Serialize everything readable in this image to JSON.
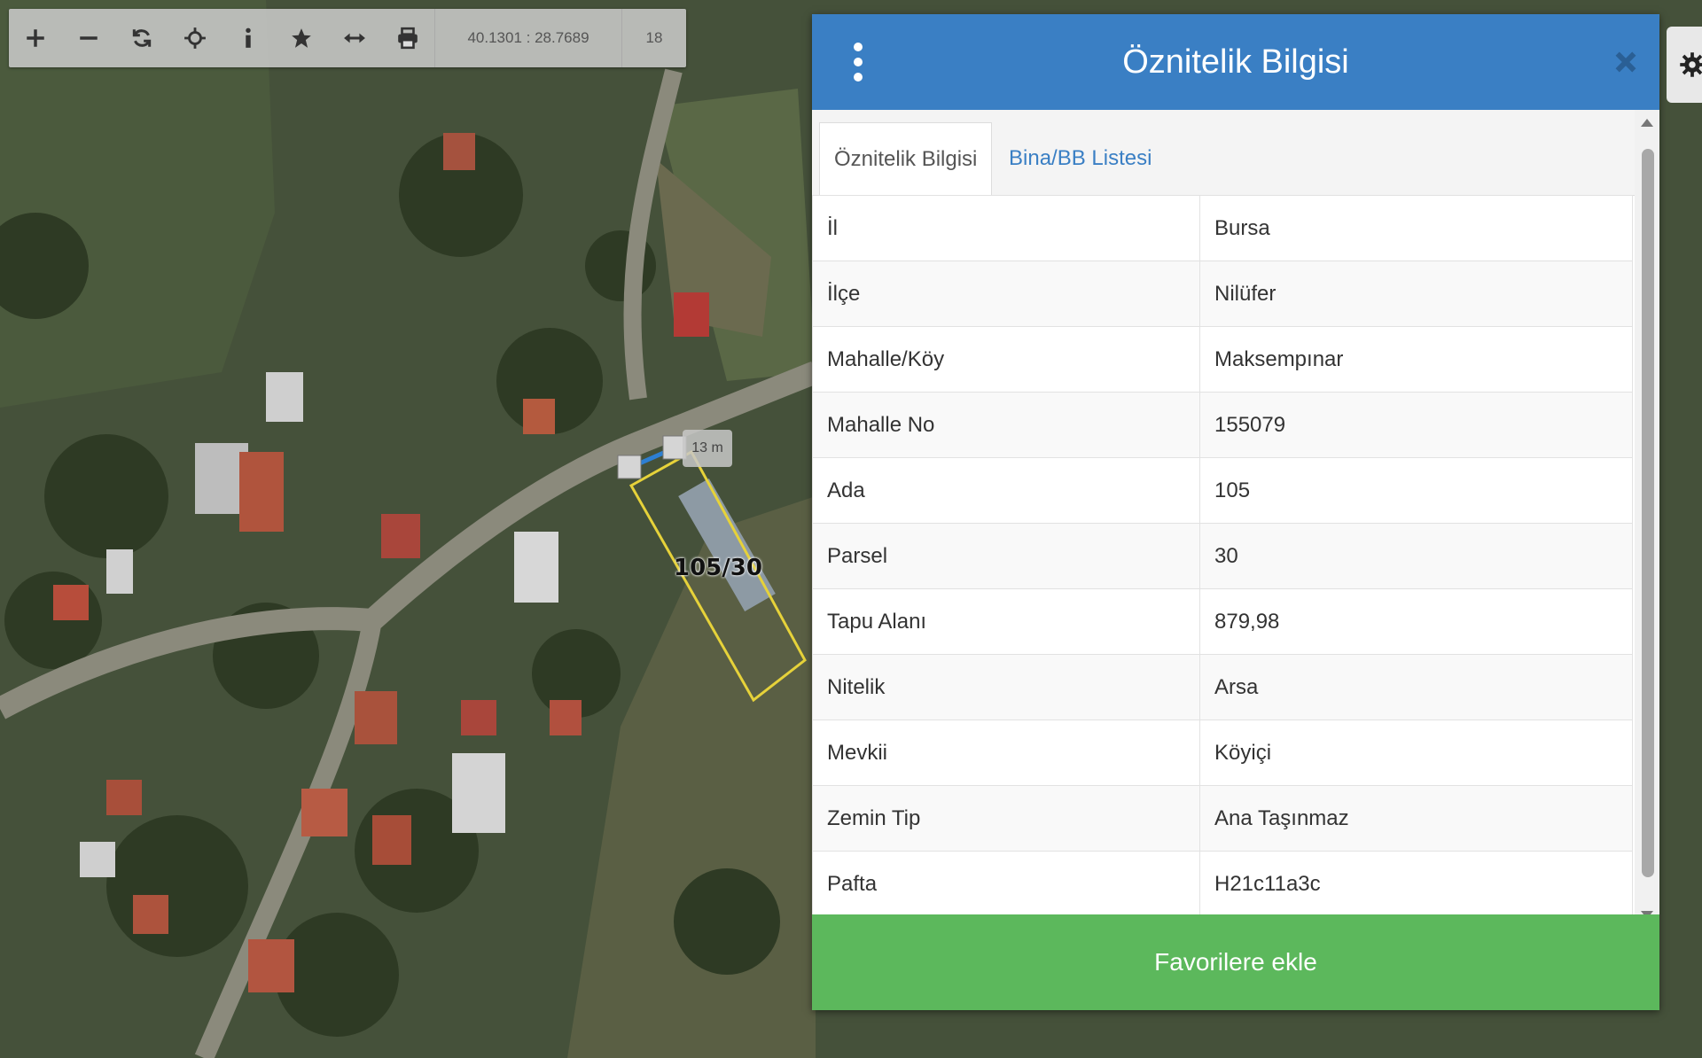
{
  "toolbar": {
    "buttons": [
      "zoom-in",
      "zoom-out",
      "refresh",
      "locate",
      "info",
      "favorite",
      "measure",
      "print"
    ],
    "coordinates": "40.1301 : 28.7689",
    "zoom_level": "18"
  },
  "map": {
    "parcel_label": "105/30",
    "measure_label": "13 m"
  },
  "panel": {
    "title": "Öznitelik Bilgisi",
    "tabs": [
      "Öznitelik Bilgisi",
      "Bina/BB Listesi"
    ],
    "rows": [
      {
        "key": "İl",
        "value": "Bursa"
      },
      {
        "key": "İlçe",
        "value": "Nilüfer"
      },
      {
        "key": "Mahalle/Köy",
        "value": "Maksempınar"
      },
      {
        "key": "Mahalle No",
        "value": "155079"
      },
      {
        "key": "Ada",
        "value": "105"
      },
      {
        "key": "Parsel",
        "value": "30"
      },
      {
        "key": "Tapu Alanı",
        "value": "879,98"
      },
      {
        "key": "Nitelik",
        "value": "Arsa"
      },
      {
        "key": "Mevkii",
        "value": "Köyiçi"
      },
      {
        "key": "Zemin Tip",
        "value": "Ana Taşınmaz"
      },
      {
        "key": "Pafta",
        "value": "H21c11a3c"
      }
    ],
    "favorite_button": "Favorilere ekle"
  },
  "colors": {
    "header": "#3a7fc4",
    "favorite": "#5cb85c",
    "parcel_outline": "#e6d23a"
  }
}
